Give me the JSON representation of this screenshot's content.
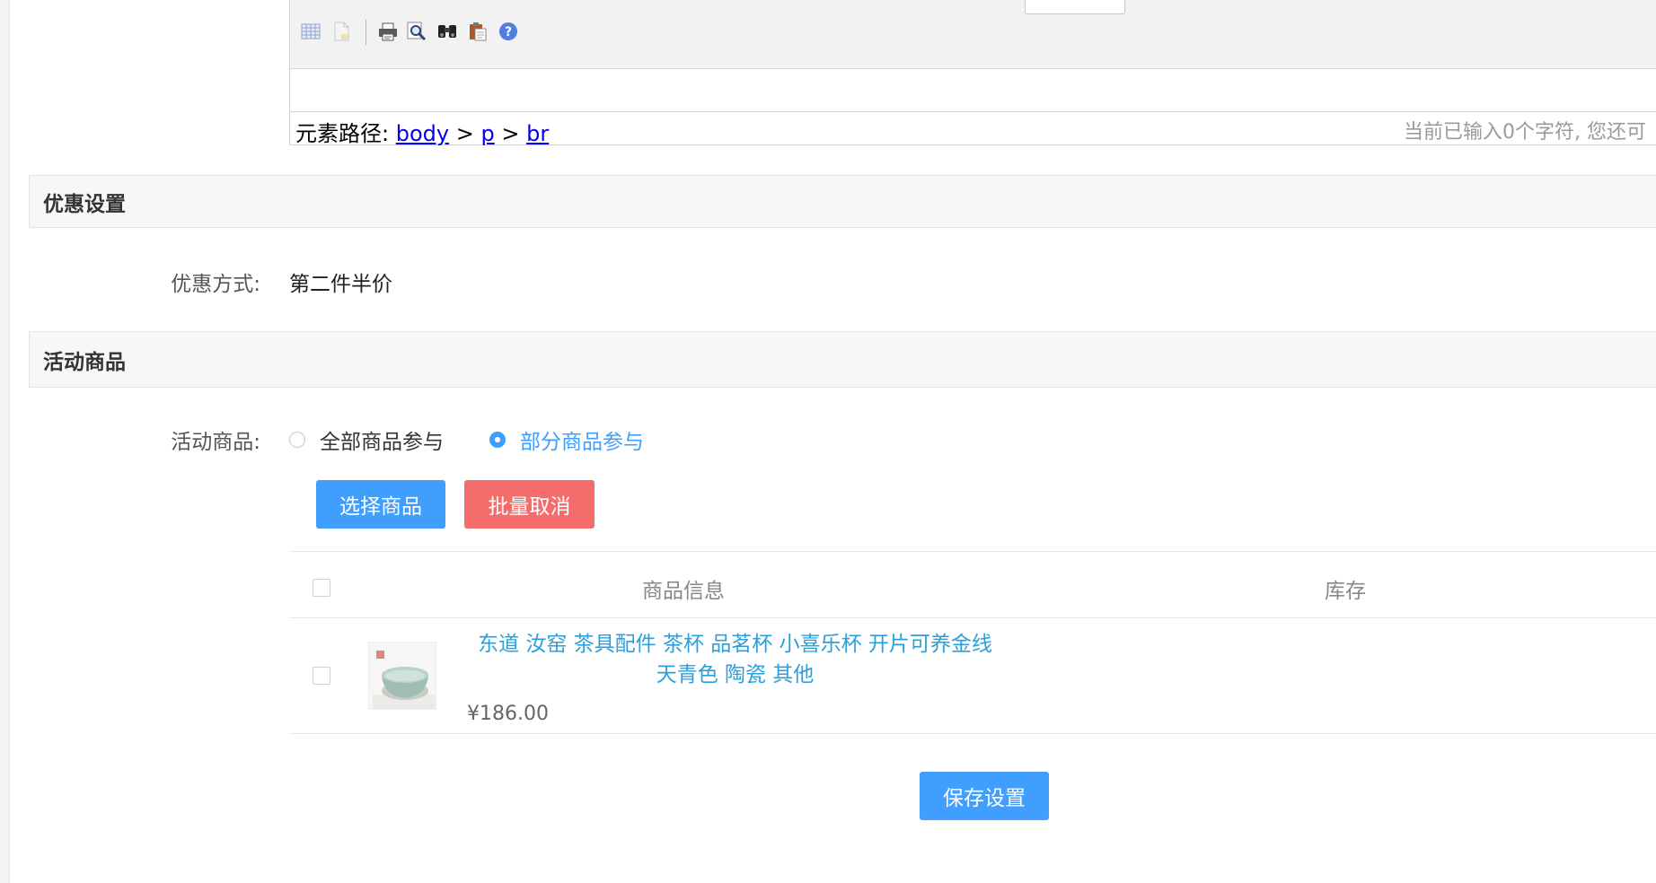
{
  "editor": {
    "path_label": "元素路径:",
    "path_items": [
      "body",
      "p",
      "br"
    ],
    "path_separator": ">",
    "char_count_text": "当前已输入0个字符, 您还可",
    "toolbar_icons": [
      "table-icon",
      "page-icon",
      "print-icon",
      "preview-icon",
      "find-icon",
      "paste-icon",
      "help-icon"
    ]
  },
  "discount_section": {
    "title": "优惠设置",
    "method_label": "优惠方式:",
    "method_value": "第二件半价"
  },
  "products_section": {
    "title": "活动商品",
    "scope_label": "活动商品:",
    "options": [
      {
        "label": "全部商品参与",
        "checked": false
      },
      {
        "label": "部分商品参与",
        "checked": true
      }
    ],
    "select_button": "选择商品",
    "batch_cancel_button": "批量取消"
  },
  "table": {
    "headers": {
      "info": "商品信息",
      "stock": "库存"
    },
    "rows": [
      {
        "name_line1": "东道 汝窑 茶具配件 茶杯 品茗杯 小喜乐杯 开片可养金线",
        "name_line2": "天青色 陶瓷 其他",
        "price": "¥186.00",
        "stock": ""
      }
    ]
  },
  "save_button": "保存设置",
  "colors": {
    "primary": "#409eff",
    "danger": "#f56c6c",
    "link": "#2d9fd8"
  }
}
